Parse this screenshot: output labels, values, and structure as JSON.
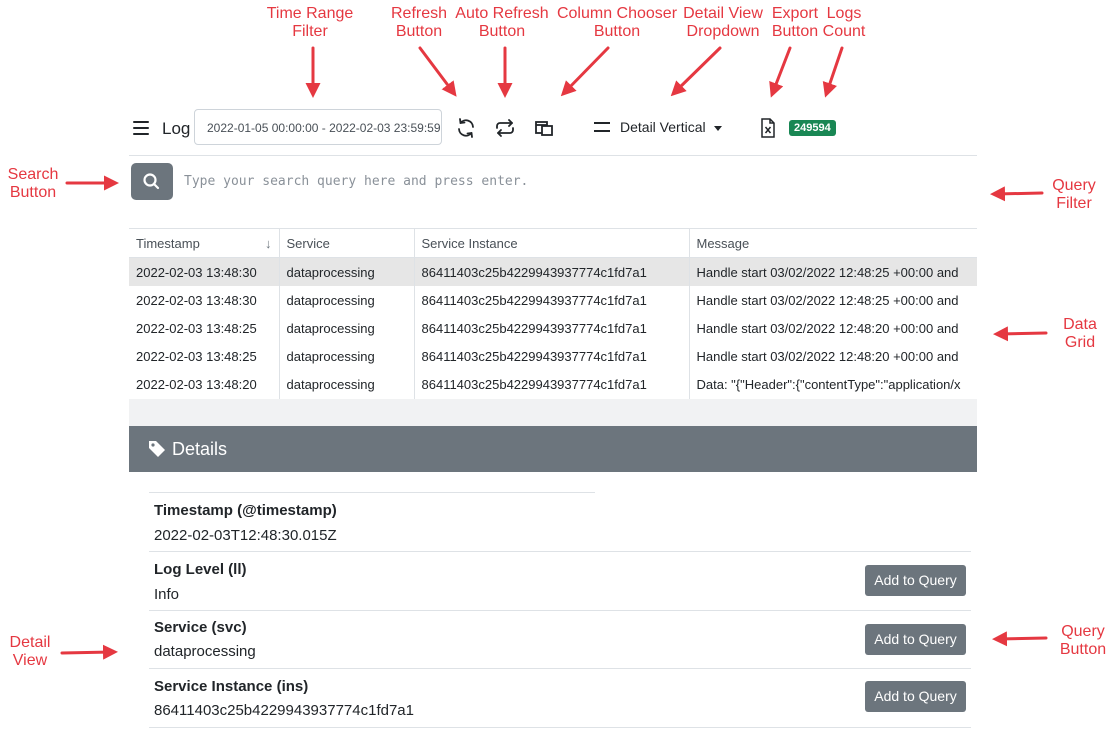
{
  "annotations": {
    "time_range_filter": "Time Range\nFilter",
    "refresh_button": "Refresh\nButton",
    "auto_refresh_button": "Auto Refresh\nButton",
    "column_chooser_button": "Column Chooser\nButton",
    "detail_view_dropdown": "Detail View\nDropdown",
    "export_button": "Export\nButton",
    "logs_count": "Logs\nCount",
    "search_button": "Search\nButton",
    "query_filter": "Query\nFilter",
    "data_grid": "Data\nGrid",
    "detail_view": "Detail\nView",
    "query_button": "Query\nButton"
  },
  "toolbar": {
    "title": "Log",
    "time_range": "2022-01-05 00:00:00 - 2022-02-03 23:59:59",
    "detail_view_label": "Detail Vertical",
    "logs_count": "249594"
  },
  "search": {
    "placeholder": "Type your search query here and press enter."
  },
  "grid": {
    "columns": [
      "Timestamp",
      "Service",
      "Service Instance",
      "Message"
    ],
    "rows": [
      [
        "2022-02-03 13:48:30",
        "dataprocessing",
        "86411403c25b4229943937774c1fd7a1",
        "Handle start 03/02/2022 12:48:25 +00:00 and"
      ],
      [
        "2022-02-03 13:48:30",
        "dataprocessing",
        "86411403c25b4229943937774c1fd7a1",
        "Handle start 03/02/2022 12:48:25 +00:00 and"
      ],
      [
        "2022-02-03 13:48:25",
        "dataprocessing",
        "86411403c25b4229943937774c1fd7a1",
        "Handle start 03/02/2022 12:48:20 +00:00 and"
      ],
      [
        "2022-02-03 13:48:25",
        "dataprocessing",
        "86411403c25b4229943937774c1fd7a1",
        "Handle start 03/02/2022 12:48:20 +00:00 and"
      ],
      [
        "2022-02-03 13:48:20",
        "dataprocessing",
        "86411403c25b4229943937774c1fd7a1",
        "Data: \"{\"Header\":{\"contentType\":\"application/x"
      ]
    ]
  },
  "details": {
    "header": "Details",
    "add_label": "Add to Query",
    "fields": [
      {
        "name": "Timestamp (@timestamp)",
        "value": "2022-02-03T12:48:30.015Z"
      },
      {
        "name": "Log Level (ll)",
        "value": "Info"
      },
      {
        "name": "Service (svc)",
        "value": "dataprocessing"
      },
      {
        "name": "Service Instance (ins)",
        "value": "86411403c25b4229943937774c1fd7a1"
      }
    ]
  },
  "colors": {
    "annotation": "#e53841",
    "badge": "#198754",
    "button": "#6c757d",
    "selected_row": "#e6e6e6"
  }
}
